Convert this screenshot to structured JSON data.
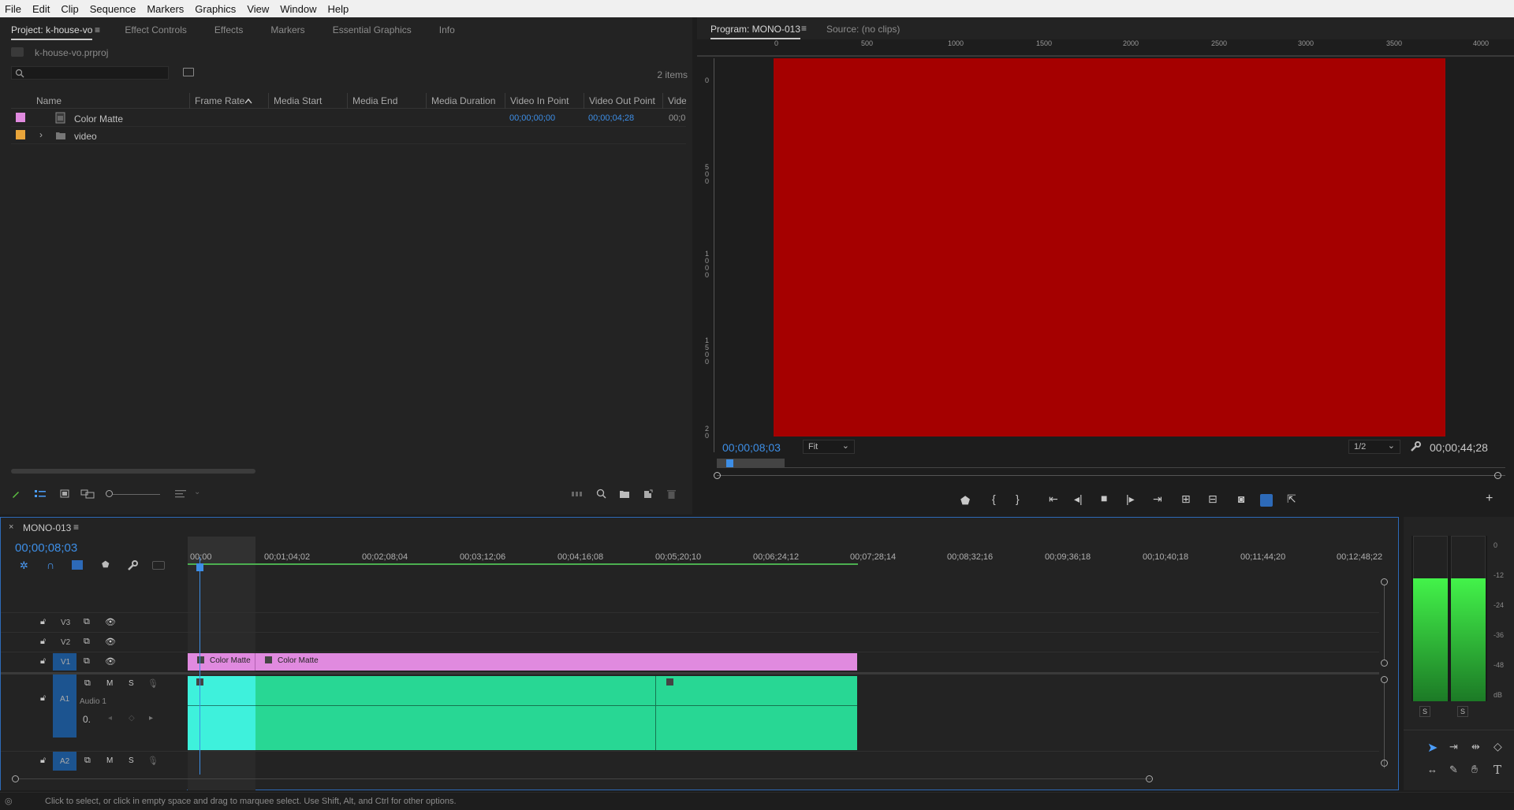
{
  "menu": [
    "File",
    "Edit",
    "Clip",
    "Sequence",
    "Markers",
    "Graphics",
    "View",
    "Window",
    "Help"
  ],
  "project": {
    "tabs": [
      "Project: k-house-vo",
      "Effect Controls",
      "Effects",
      "Markers",
      "Essential Graphics",
      "Info"
    ],
    "filename": "k-house-vo.prproj",
    "items_count": "2 items",
    "columns": [
      "Name",
      "Frame Rate",
      "Media Start",
      "Media End",
      "Media Duration",
      "Video In Point",
      "Video Out Point",
      "Vide"
    ],
    "rows": [
      {
        "name": "Color Matte",
        "in_point": "00;00;00;00",
        "out_point": "00;00;04;28",
        "extra": "00;0",
        "color": "#e08adf"
      },
      {
        "name": "video",
        "color": "#e8a43a"
      }
    ]
  },
  "program": {
    "tabs": [
      "Program: MONO-013",
      "Source: (no clips)"
    ],
    "ruler_h": [
      "0",
      "500",
      "1000",
      "1500",
      "2000",
      "2500",
      "3000",
      "3500",
      "4000"
    ],
    "ruler_v": [
      "0",
      "5\n0\n0",
      "1\n0\n0\n0",
      "1\n5\n0\n0",
      "2\n0"
    ],
    "timecode": "00;00;08;03",
    "fit": "Fit",
    "resolution": "1/2",
    "duration": "00;00;44;28",
    "frame_color": "#a50000"
  },
  "timeline": {
    "sequence_name": "MONO-013",
    "timecode": "00;00;08;03",
    "ruler_labels": [
      "00;00",
      "00;01;04;02",
      "00;02;08;04",
      "00;03;12;06",
      "00;04;16;08",
      "00;05;20;10",
      "00;06;24;12",
      "00;07;28;14",
      "00;08;32;16",
      "00;09;36;18",
      "00;10;40;18",
      "00;11;44;20",
      "00;12;48;22"
    ],
    "video_tracks": [
      "V3",
      "V2",
      "V1"
    ],
    "audio_tracks": [
      "A1",
      "A2"
    ],
    "audio_track_name": "Audio 1",
    "volume_value": "0.",
    "clips": [
      {
        "label": "Color Matte"
      },
      {
        "label": "Color Matte"
      }
    ],
    "track_buttons": {
      "mute": "M",
      "solo": "S"
    }
  },
  "meter": {
    "scale": [
      "0",
      "-12",
      "-24",
      "-36",
      "-48",
      "dB"
    ],
    "solo_labels": [
      "S",
      "S"
    ]
  },
  "status": {
    "text": "Click to select, or click in empty space and drag to marquee select. Use Shift, Alt, and Ctrl for other options."
  }
}
